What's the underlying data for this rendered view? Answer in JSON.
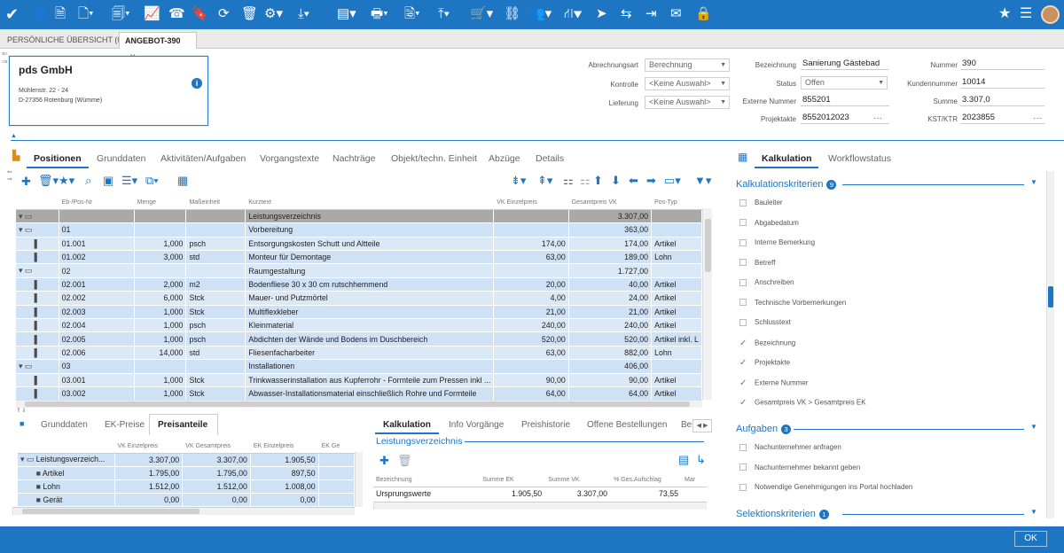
{
  "toolbar": {
    "icons": [
      "home-check-icon",
      "add-person-icon",
      "add-document-icon",
      "new-document-icon",
      "copy-document-icon",
      "chart-icon",
      "phone-icon",
      "bookmark-icon",
      "refresh-icon",
      "delete-icon",
      "settings-icon",
      "download-icon",
      "layout-icon",
      "print-icon",
      "report-icon",
      "upload-icon",
      "cart-icon",
      "link-icon",
      "team-icon",
      "hierarchy-icon",
      "send-icon",
      "transfer-icon",
      "export-icon",
      "mail-icon",
      "lock-icon"
    ],
    "right_icons": [
      "star-icon",
      "menu-icon"
    ]
  },
  "tabs": [
    {
      "label": "PERSÖNLICHE ÜBERSICHT (0)",
      "active": false
    },
    {
      "label": "ANGEBOT-390",
      "active": true
    }
  ],
  "address": {
    "name": "pds GmbH",
    "street": "Mühlenstr. 22 - 24",
    "city": "D-27356 Rotenburg (Wümme)"
  },
  "fields_mid": [
    {
      "label": "Abrechnungsart",
      "value": "Berechnung"
    },
    {
      "label": "Kontrolle",
      "value": "<Keine Auswahl>"
    },
    {
      "label": "Lieferung",
      "value": "<Keine Auswahl>"
    }
  ],
  "fields_right": {
    "bezeichnung_label": "Bezeichnung",
    "bezeichnung": "Sanierung Gästebad",
    "status_label": "Status",
    "status": "Offen",
    "extnr_label": "Externe Nummer",
    "extnr": "855201",
    "projekt_label": "Projektakte",
    "projekt": "8552012023",
    "nummer_label": "Nummer",
    "nummer": "390",
    "kunde_label": "Kundennummer",
    "kunde": "10014",
    "summe_label": "Summe",
    "summe": "3.307,0",
    "kst_label": "KST/KTR",
    "kst": "2023855"
  },
  "subtabs": [
    "Positionen",
    "Grunddaten",
    "Aktivitäten/Aufgaben",
    "Vorgangstexte",
    "Nachträge",
    "Objekt/techn. Einheit",
    "Abzüge",
    "Details"
  ],
  "grid": {
    "headers": [
      "Eb-/Pos-Nr",
      "Menge",
      "Maßeinheit",
      "Kurztext",
      "VK Einzelpreis",
      "Gesamtpreis VK",
      "Pos-Typ"
    ],
    "rows": [
      {
        "pos": "",
        "menge": "",
        "me": "",
        "text": "Leistungsverzeichnis",
        "ep": "",
        "gp": "3.307,00",
        "typ": "",
        "kind": "root"
      },
      {
        "pos": "01",
        "menge": "",
        "me": "",
        "text": "Vorbereitung",
        "ep": "",
        "gp": "363,00",
        "typ": "",
        "kind": "folder"
      },
      {
        "pos": "01.001",
        "menge": "1,000",
        "me": "psch",
        "text": "Entsorgungskosten Schutt und Altteile",
        "ep": "174,00",
        "gp": "174,00",
        "typ": "Artikel",
        "kind": "doc"
      },
      {
        "pos": "01.002",
        "menge": "3,000",
        "me": "std",
        "text": "Monteur für Demontage",
        "ep": "63,00",
        "gp": "189,00",
        "typ": "Lohn",
        "kind": "doc"
      },
      {
        "pos": "02",
        "menge": "",
        "me": "",
        "text": "Raumgestaltung",
        "ep": "",
        "gp": "1.727,00",
        "typ": "",
        "kind": "folder"
      },
      {
        "pos": "02.001",
        "menge": "2,000",
        "me": "m2",
        "text": "Bodenfliese 30 x 30 cm rutschhemmend",
        "ep": "20,00",
        "gp": "40,00",
        "typ": "Artikel",
        "kind": "doc"
      },
      {
        "pos": "02.002",
        "menge": "6,000",
        "me": "Stck",
        "text": "Mauer- und Putzmörtel",
        "ep": "4,00",
        "gp": "24,00",
        "typ": "Artikel",
        "kind": "doc"
      },
      {
        "pos": "02.003",
        "menge": "1,000",
        "me": "Stck",
        "text": "Multiflexkleber",
        "ep": "21,00",
        "gp": "21,00",
        "typ": "Artikel",
        "kind": "doc"
      },
      {
        "pos": "02.004",
        "menge": "1,000",
        "me": "psch",
        "text": "Kleinmaterial",
        "ep": "240,00",
        "gp": "240,00",
        "typ": "Artikel",
        "kind": "doc"
      },
      {
        "pos": "02.005",
        "menge": "1,000",
        "me": "psch",
        "text": "Abdichten der Wände und Bodens im Duschbereich",
        "ep": "520,00",
        "gp": "520,00",
        "typ": "Artikel inkl. L",
        "kind": "doc"
      },
      {
        "pos": "02.006",
        "menge": "14,000",
        "me": "std",
        "text": "Fliesenfacharbeiter",
        "ep": "63,00",
        "gp": "882,00",
        "typ": "Lohn",
        "kind": "doc"
      },
      {
        "pos": "03",
        "menge": "",
        "me": "",
        "text": "Installationen",
        "ep": "",
        "gp": "406,00",
        "typ": "",
        "kind": "folder"
      },
      {
        "pos": "03.001",
        "menge": "1,000",
        "me": "Stck",
        "text": "Trinkwasserinstallation aus Kupferrohr - Formteile zum Pressen inkl ...",
        "ep": "90,00",
        "gp": "90,00",
        "typ": "Artikel",
        "kind": "doc"
      },
      {
        "pos": "03.002",
        "menge": "1,000",
        "me": "Stck",
        "text": "Abwasser-Installationsmaterial einschließlich Rohre und Formteile",
        "ep": "64,00",
        "gp": "64,00",
        "typ": "Artikel",
        "kind": "doc"
      }
    ]
  },
  "right_panel": {
    "tabs": [
      "Kalkulation",
      "Workflowstatus"
    ],
    "kk_title": "Kalkulationskriterien",
    "kk_count": "9",
    "kk_items": [
      {
        "label": "Bauleiter",
        "checked": false
      },
      {
        "label": "Abgabedatum",
        "checked": false
      },
      {
        "label": "Interne Bemerkung",
        "checked": false
      },
      {
        "label": "Betreff",
        "checked": false
      },
      {
        "label": "Anschreiben",
        "checked": false
      },
      {
        "label": "Technische Vorbemerkungen",
        "checked": false
      },
      {
        "label": "Schlusstext",
        "checked": false
      },
      {
        "label": "Bezeichnung",
        "checked": true
      },
      {
        "label": "Projektakte",
        "checked": true
      },
      {
        "label": "Externe Nummer",
        "checked": true
      },
      {
        "label": "Gesamtpreis VK > Gesamtpreis EK",
        "checked": true
      }
    ],
    "aufgaben_title": "Aufgaben",
    "aufgaben_count": "3",
    "aufgaben_items": [
      {
        "label": "Nachunternehmer anfragen"
      },
      {
        "label": "Nachunternehmer bekannt geben"
      },
      {
        "label": "Notwendige Genehmigungen ins Portal hochladen"
      }
    ],
    "sel_title": "Selektionskriterien",
    "sel_count": "1"
  },
  "bottom_left": {
    "tabs": [
      "Grunddaten",
      "EK-Preise",
      "Preisanteile"
    ],
    "headers": [
      "",
      "VK Einzelpreis",
      "VK Gesamtpreis",
      "EK Einzelpreis",
      "EK Ge"
    ],
    "rows": [
      {
        "name": "Leistungsverzeich...",
        "a": "3.307,00",
        "b": "3.307,00",
        "c": "1.905,50"
      },
      {
        "name": "Artikel",
        "a": "1.795,00",
        "b": "1.795,00",
        "c": "897,50"
      },
      {
        "name": "Lohn",
        "a": "1.512,00",
        "b": "1.512,00",
        "c": "1.008,00"
      },
      {
        "name": "Gerät",
        "a": "0,00",
        "b": "0,00",
        "c": "0,00"
      }
    ]
  },
  "bottom_right": {
    "tabs": [
      "Kalkulation",
      "Info Vorgänge",
      "Preishistorie",
      "Offene Bestellungen",
      "Be"
    ],
    "section": "Leistungsverzeichnis",
    "headers": [
      "Bezeichnung",
      "Summe EK",
      "Summe VK",
      "% Ges.Aufschlag",
      "Mar"
    ],
    "row": {
      "name": "Ursprungswerte",
      "ek": "1.905,50",
      "vk": "3.307,00",
      "auf": "73,55"
    }
  },
  "footer": {
    "ok": "OK"
  }
}
